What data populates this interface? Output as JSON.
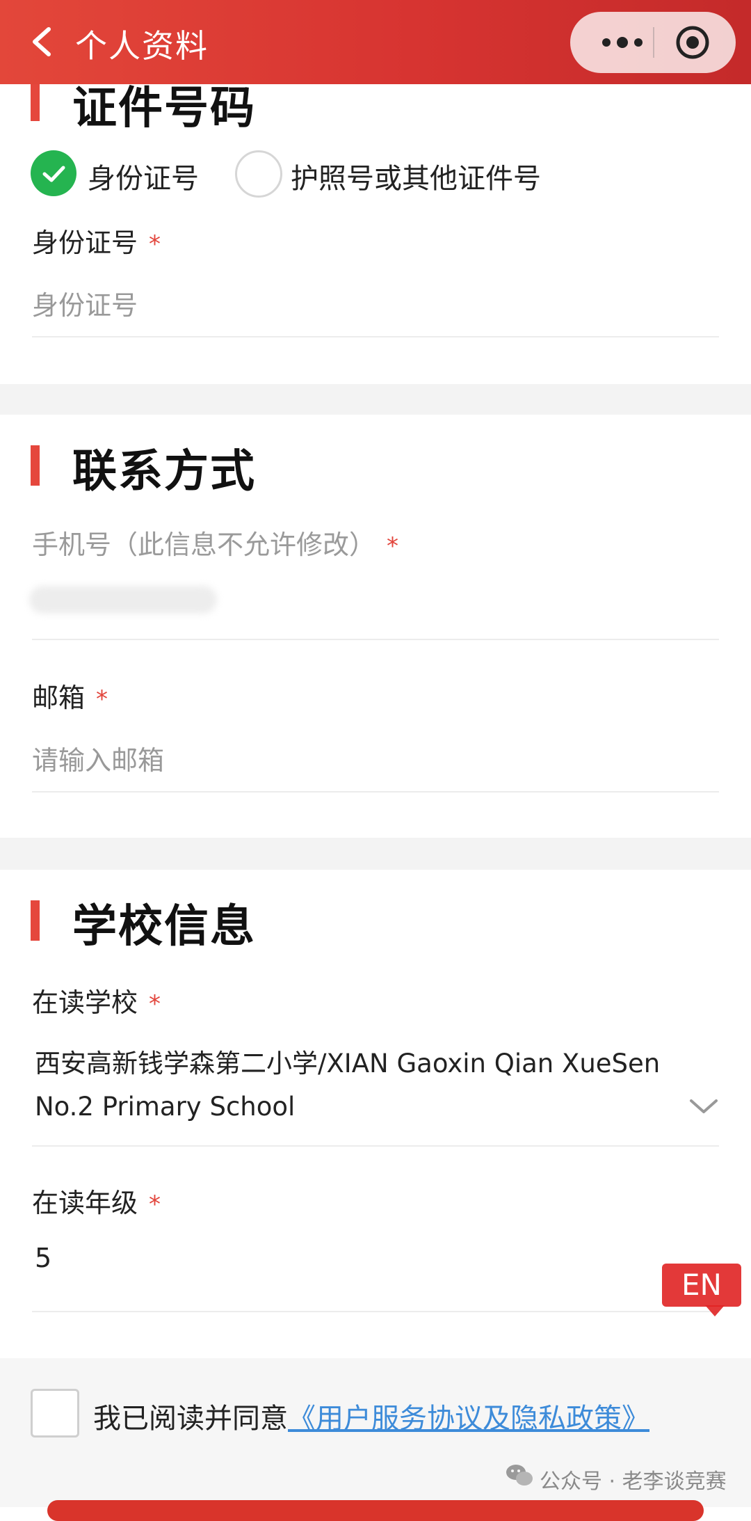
{
  "nav": {
    "title": "个人资料",
    "accent": "#d73431"
  },
  "id_section": {
    "title": "证件号码",
    "options": [
      "身份证号",
      "护照号或其他证件号"
    ],
    "selected": "身份证号",
    "field_label": "身份证号",
    "required_mark": "*",
    "placeholder": "身份证号"
  },
  "contact_section": {
    "title": "联系方式",
    "phone_label": "手机号（此信息不允许修改）",
    "email_label": "邮箱",
    "email_placeholder": "请输入邮箱",
    "required_mark": "*"
  },
  "school_section": {
    "title": "学校信息",
    "school_label": "在读学校",
    "school_value": "西安高新钱学森第二小学/XIAN Gaoxin Qian XueSen No.2 Primary School",
    "grade_label": "在读年级",
    "grade_value": "5",
    "required_mark": "*"
  },
  "lang_badge": "EN",
  "agreement": {
    "text": "我已阅读并同意",
    "link": "《用户服务协议及隐私政策》"
  },
  "watermark": "公众号 · 老李谈竞赛",
  "colors": {
    "check_green": "#25b450",
    "required_red": "#e2453c",
    "link_blue": "#3d8bd9"
  }
}
